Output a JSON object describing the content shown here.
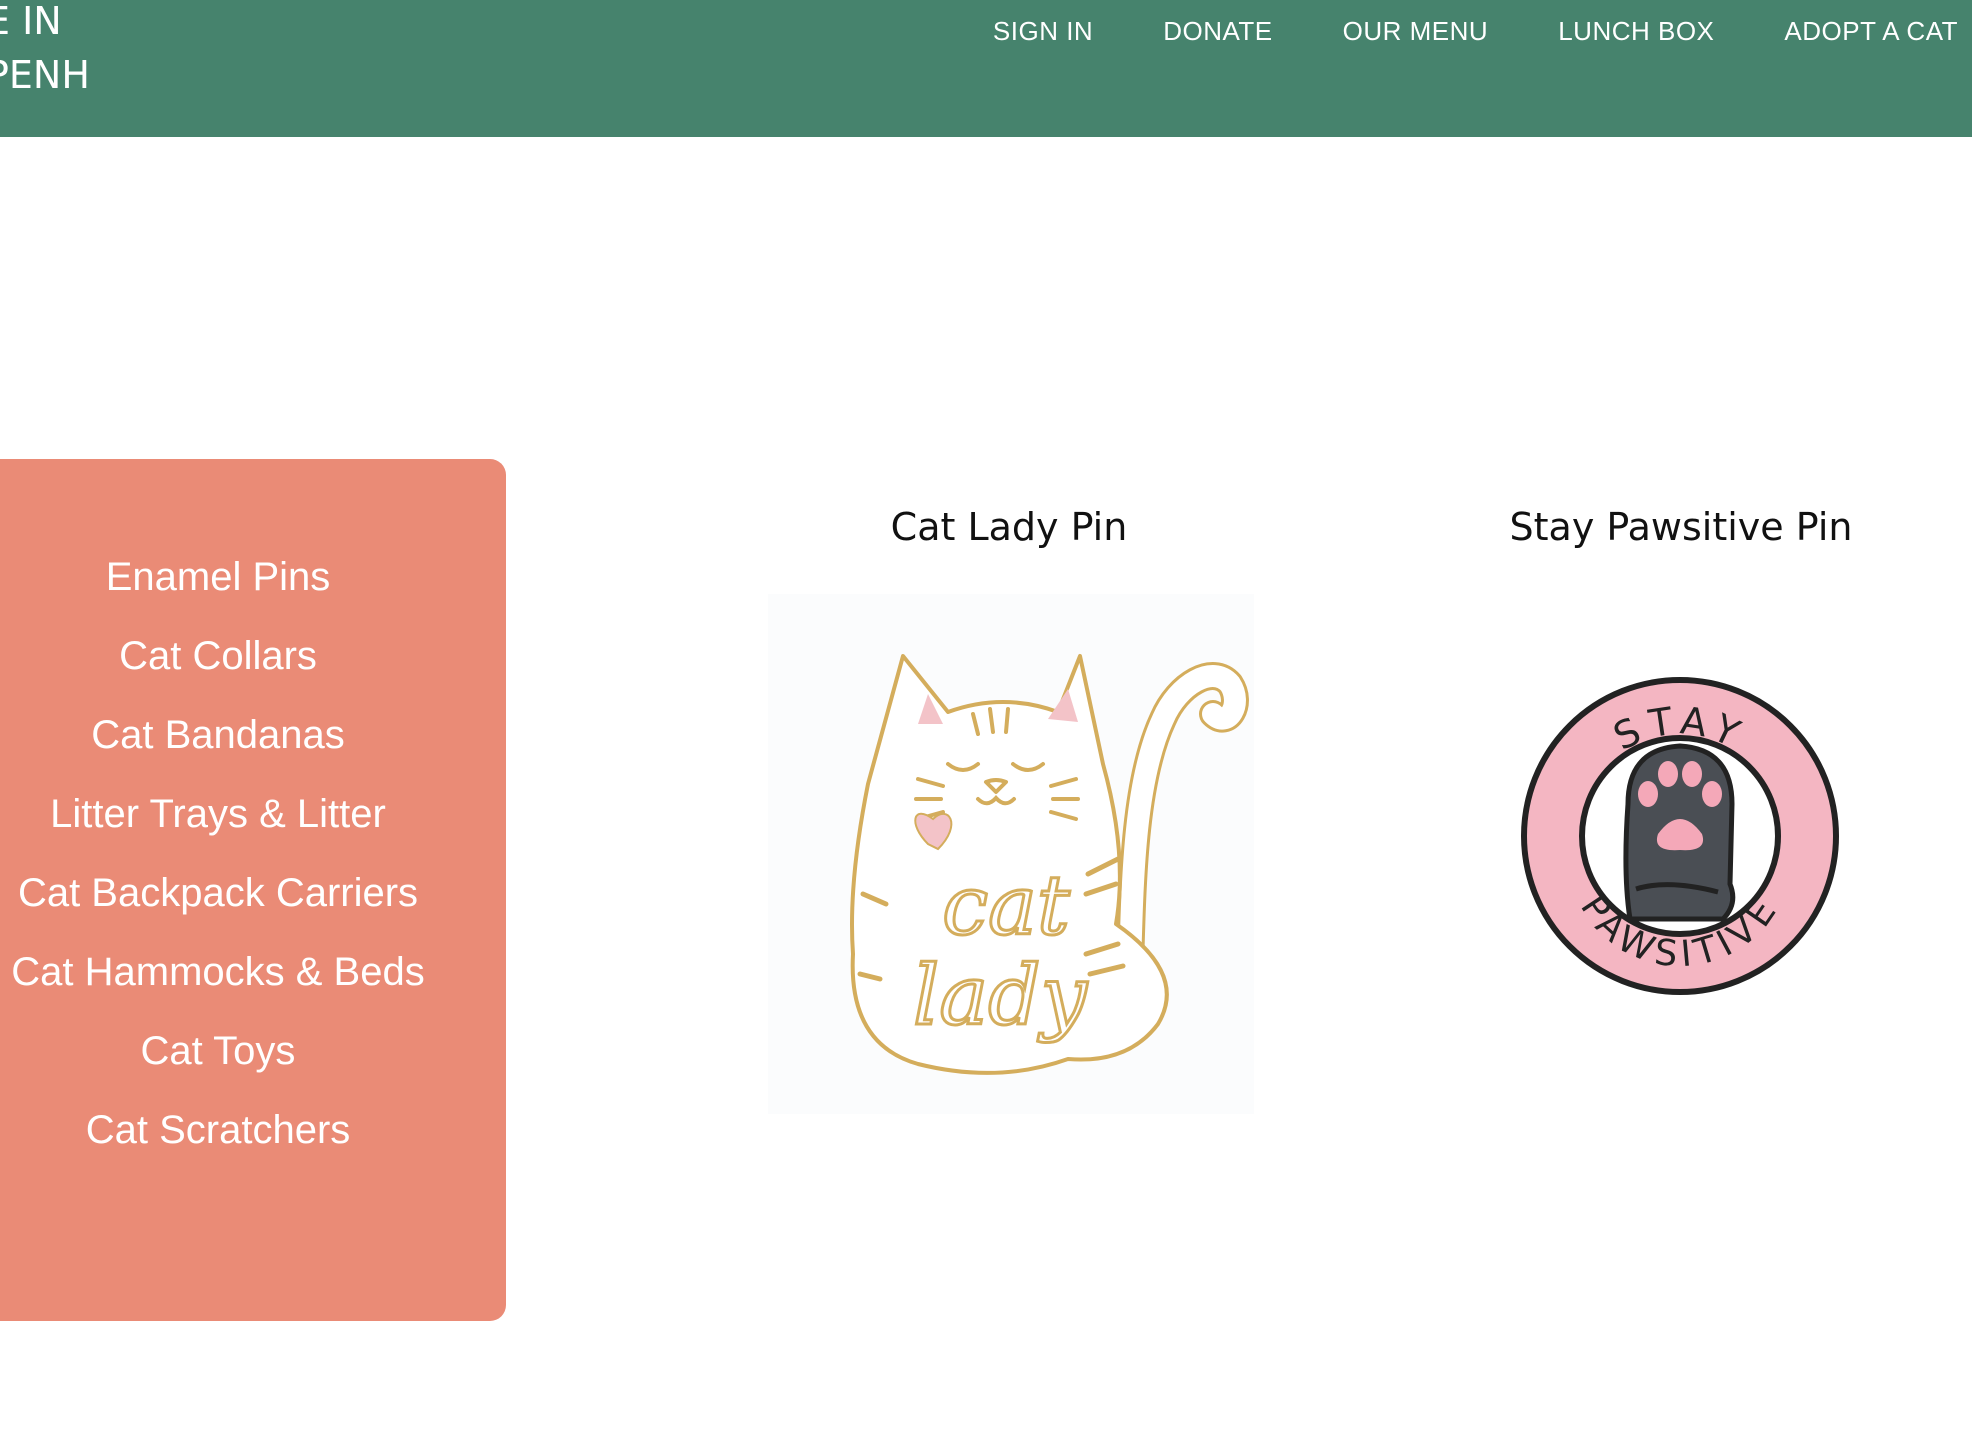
{
  "header": {
    "brand_line1": "E IN",
    "brand_line2": "PENH",
    "nav": [
      "SIGN IN",
      "DONATE",
      "OUR MENU",
      "LUNCH BOX",
      "ADOPT A CAT"
    ]
  },
  "sidebar": {
    "categories": [
      "Enamel Pins",
      "Cat Collars",
      "Cat Bandanas",
      "Litter Trays & Litter",
      "Cat Backpack Carriers",
      "Cat Hammocks & Beds",
      "Cat Toys",
      "Cat Scratchers"
    ]
  },
  "products": [
    {
      "title": "Cat Lady Pin",
      "image_text": [
        "cat",
        "lady"
      ]
    },
    {
      "title": "Stay Pawsitive Pin",
      "image_text": [
        "STAY",
        "PAWSITIVE"
      ]
    }
  ],
  "colors": {
    "header_bg": "#46836d",
    "sidebar_bg": "#ea8b76",
    "pin_gold": "#d4ad5c",
    "pin_pink": "#f4b6c2",
    "paw_gray": "#4a4e54"
  }
}
